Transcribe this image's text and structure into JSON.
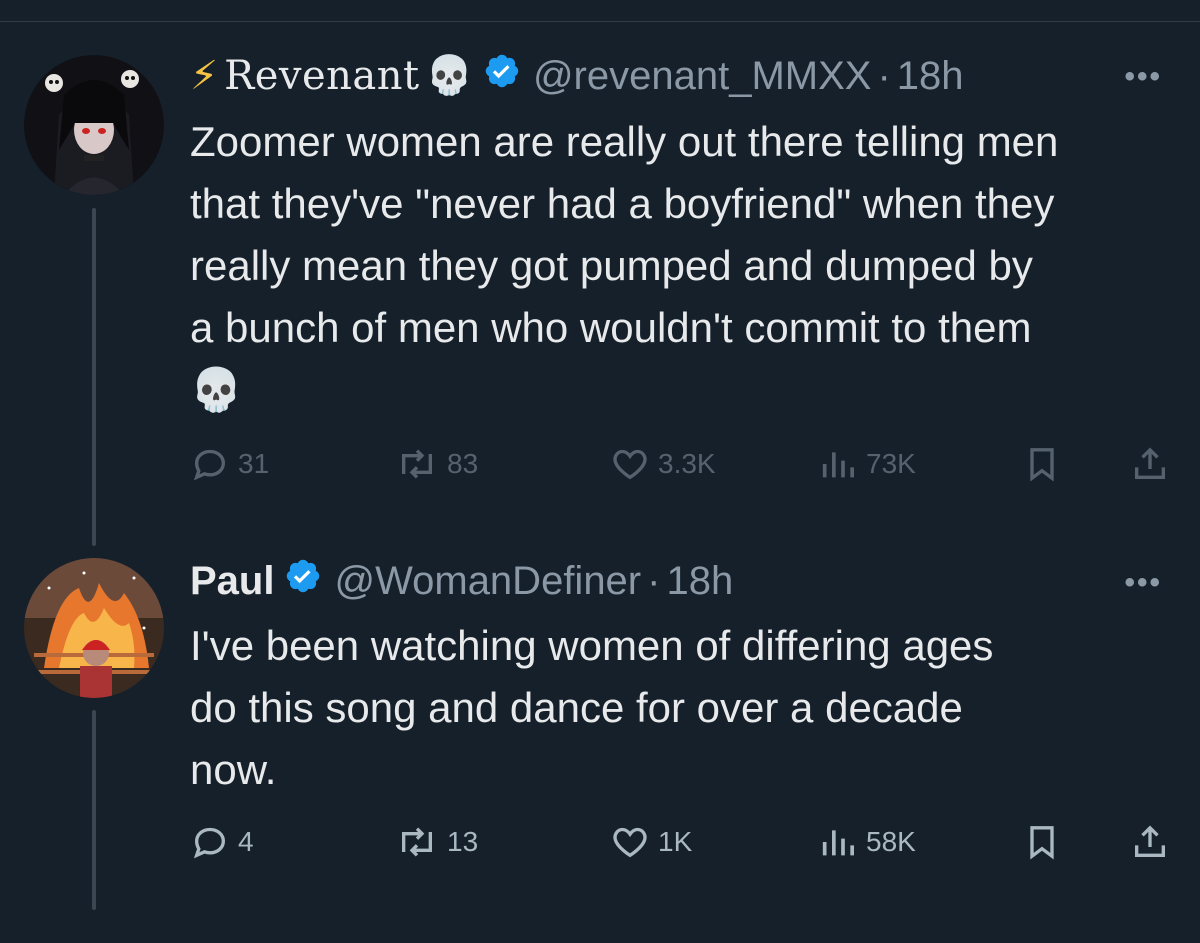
{
  "tweets": [
    {
      "display_name": "Revenant",
      "handle": "@revenant_MMXX",
      "separator": "·",
      "time": "18h",
      "more": "•••",
      "text": "Zoomer women are really out there telling men\nthat they've \"never had a boyfriend\" when they\nreally mean they got pumped and dumped by\na bunch of men who wouldn't commit to them\n💀",
      "name_prefix_emoji": "⚡",
      "name_suffix_emoji": "💀",
      "replies": "31",
      "reposts": "83",
      "likes": "3.3K",
      "views": "73K"
    },
    {
      "display_name": "Paul",
      "handle": "@WomanDefiner",
      "separator": "·",
      "time": "18h",
      "more": "•••",
      "text": "I've been watching women of differing ages\ndo this song and dance for over a decade\nnow.",
      "replies": "4",
      "reposts": "13",
      "likes": "1K",
      "views": "58K"
    }
  ],
  "icons": {
    "reply": "reply-icon",
    "repost": "repost-icon",
    "like": "heart-icon",
    "views": "views-icon",
    "bookmark": "bookmark-icon",
    "share": "share-icon",
    "verified": "verified-badge-icon"
  },
  "colors": {
    "background": "#15202b",
    "text": "#e7e9ea",
    "muted": "#8b98a5",
    "verified": "#1d9bf0",
    "bolt": "#f6c244"
  }
}
